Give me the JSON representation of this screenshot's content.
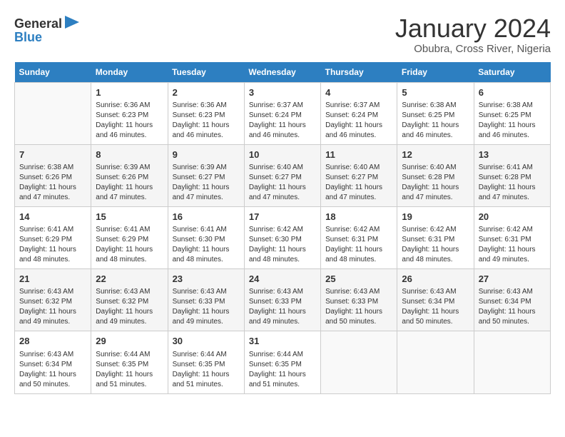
{
  "header": {
    "logo": {
      "line1": "General",
      "line2": "Blue"
    },
    "title": "January 2024",
    "location": "Obubra, Cross River, Nigeria"
  },
  "days_of_week": [
    "Sunday",
    "Monday",
    "Tuesday",
    "Wednesday",
    "Thursday",
    "Friday",
    "Saturday"
  ],
  "weeks": [
    [
      {
        "day": "",
        "info": ""
      },
      {
        "day": "1",
        "info": "Sunrise: 6:36 AM\nSunset: 6:23 PM\nDaylight: 11 hours and 46 minutes."
      },
      {
        "day": "2",
        "info": "Sunrise: 6:36 AM\nSunset: 6:23 PM\nDaylight: 11 hours and 46 minutes."
      },
      {
        "day": "3",
        "info": "Sunrise: 6:37 AM\nSunset: 6:24 PM\nDaylight: 11 hours and 46 minutes."
      },
      {
        "day": "4",
        "info": "Sunrise: 6:37 AM\nSunset: 6:24 PM\nDaylight: 11 hours and 46 minutes."
      },
      {
        "day": "5",
        "info": "Sunrise: 6:38 AM\nSunset: 6:25 PM\nDaylight: 11 hours and 46 minutes."
      },
      {
        "day": "6",
        "info": "Sunrise: 6:38 AM\nSunset: 6:25 PM\nDaylight: 11 hours and 46 minutes."
      }
    ],
    [
      {
        "day": "7",
        "info": "Sunrise: 6:38 AM\nSunset: 6:26 PM\nDaylight: 11 hours and 47 minutes."
      },
      {
        "day": "8",
        "info": "Sunrise: 6:39 AM\nSunset: 6:26 PM\nDaylight: 11 hours and 47 minutes."
      },
      {
        "day": "9",
        "info": "Sunrise: 6:39 AM\nSunset: 6:27 PM\nDaylight: 11 hours and 47 minutes."
      },
      {
        "day": "10",
        "info": "Sunrise: 6:40 AM\nSunset: 6:27 PM\nDaylight: 11 hours and 47 minutes."
      },
      {
        "day": "11",
        "info": "Sunrise: 6:40 AM\nSunset: 6:27 PM\nDaylight: 11 hours and 47 minutes."
      },
      {
        "day": "12",
        "info": "Sunrise: 6:40 AM\nSunset: 6:28 PM\nDaylight: 11 hours and 47 minutes."
      },
      {
        "day": "13",
        "info": "Sunrise: 6:41 AM\nSunset: 6:28 PM\nDaylight: 11 hours and 47 minutes."
      }
    ],
    [
      {
        "day": "14",
        "info": "Sunrise: 6:41 AM\nSunset: 6:29 PM\nDaylight: 11 hours and 48 minutes."
      },
      {
        "day": "15",
        "info": "Sunrise: 6:41 AM\nSunset: 6:29 PM\nDaylight: 11 hours and 48 minutes."
      },
      {
        "day": "16",
        "info": "Sunrise: 6:41 AM\nSunset: 6:30 PM\nDaylight: 11 hours and 48 minutes."
      },
      {
        "day": "17",
        "info": "Sunrise: 6:42 AM\nSunset: 6:30 PM\nDaylight: 11 hours and 48 minutes."
      },
      {
        "day": "18",
        "info": "Sunrise: 6:42 AM\nSunset: 6:31 PM\nDaylight: 11 hours and 48 minutes."
      },
      {
        "day": "19",
        "info": "Sunrise: 6:42 AM\nSunset: 6:31 PM\nDaylight: 11 hours and 48 minutes."
      },
      {
        "day": "20",
        "info": "Sunrise: 6:42 AM\nSunset: 6:31 PM\nDaylight: 11 hours and 49 minutes."
      }
    ],
    [
      {
        "day": "21",
        "info": "Sunrise: 6:43 AM\nSunset: 6:32 PM\nDaylight: 11 hours and 49 minutes."
      },
      {
        "day": "22",
        "info": "Sunrise: 6:43 AM\nSunset: 6:32 PM\nDaylight: 11 hours and 49 minutes."
      },
      {
        "day": "23",
        "info": "Sunrise: 6:43 AM\nSunset: 6:33 PM\nDaylight: 11 hours and 49 minutes."
      },
      {
        "day": "24",
        "info": "Sunrise: 6:43 AM\nSunset: 6:33 PM\nDaylight: 11 hours and 49 minutes."
      },
      {
        "day": "25",
        "info": "Sunrise: 6:43 AM\nSunset: 6:33 PM\nDaylight: 11 hours and 50 minutes."
      },
      {
        "day": "26",
        "info": "Sunrise: 6:43 AM\nSunset: 6:34 PM\nDaylight: 11 hours and 50 minutes."
      },
      {
        "day": "27",
        "info": "Sunrise: 6:43 AM\nSunset: 6:34 PM\nDaylight: 11 hours and 50 minutes."
      }
    ],
    [
      {
        "day": "28",
        "info": "Sunrise: 6:43 AM\nSunset: 6:34 PM\nDaylight: 11 hours and 50 minutes."
      },
      {
        "day": "29",
        "info": "Sunrise: 6:44 AM\nSunset: 6:35 PM\nDaylight: 11 hours and 51 minutes."
      },
      {
        "day": "30",
        "info": "Sunrise: 6:44 AM\nSunset: 6:35 PM\nDaylight: 11 hours and 51 minutes."
      },
      {
        "day": "31",
        "info": "Sunrise: 6:44 AM\nSunset: 6:35 PM\nDaylight: 11 hours and 51 minutes."
      },
      {
        "day": "",
        "info": ""
      },
      {
        "day": "",
        "info": ""
      },
      {
        "day": "",
        "info": ""
      }
    ]
  ]
}
